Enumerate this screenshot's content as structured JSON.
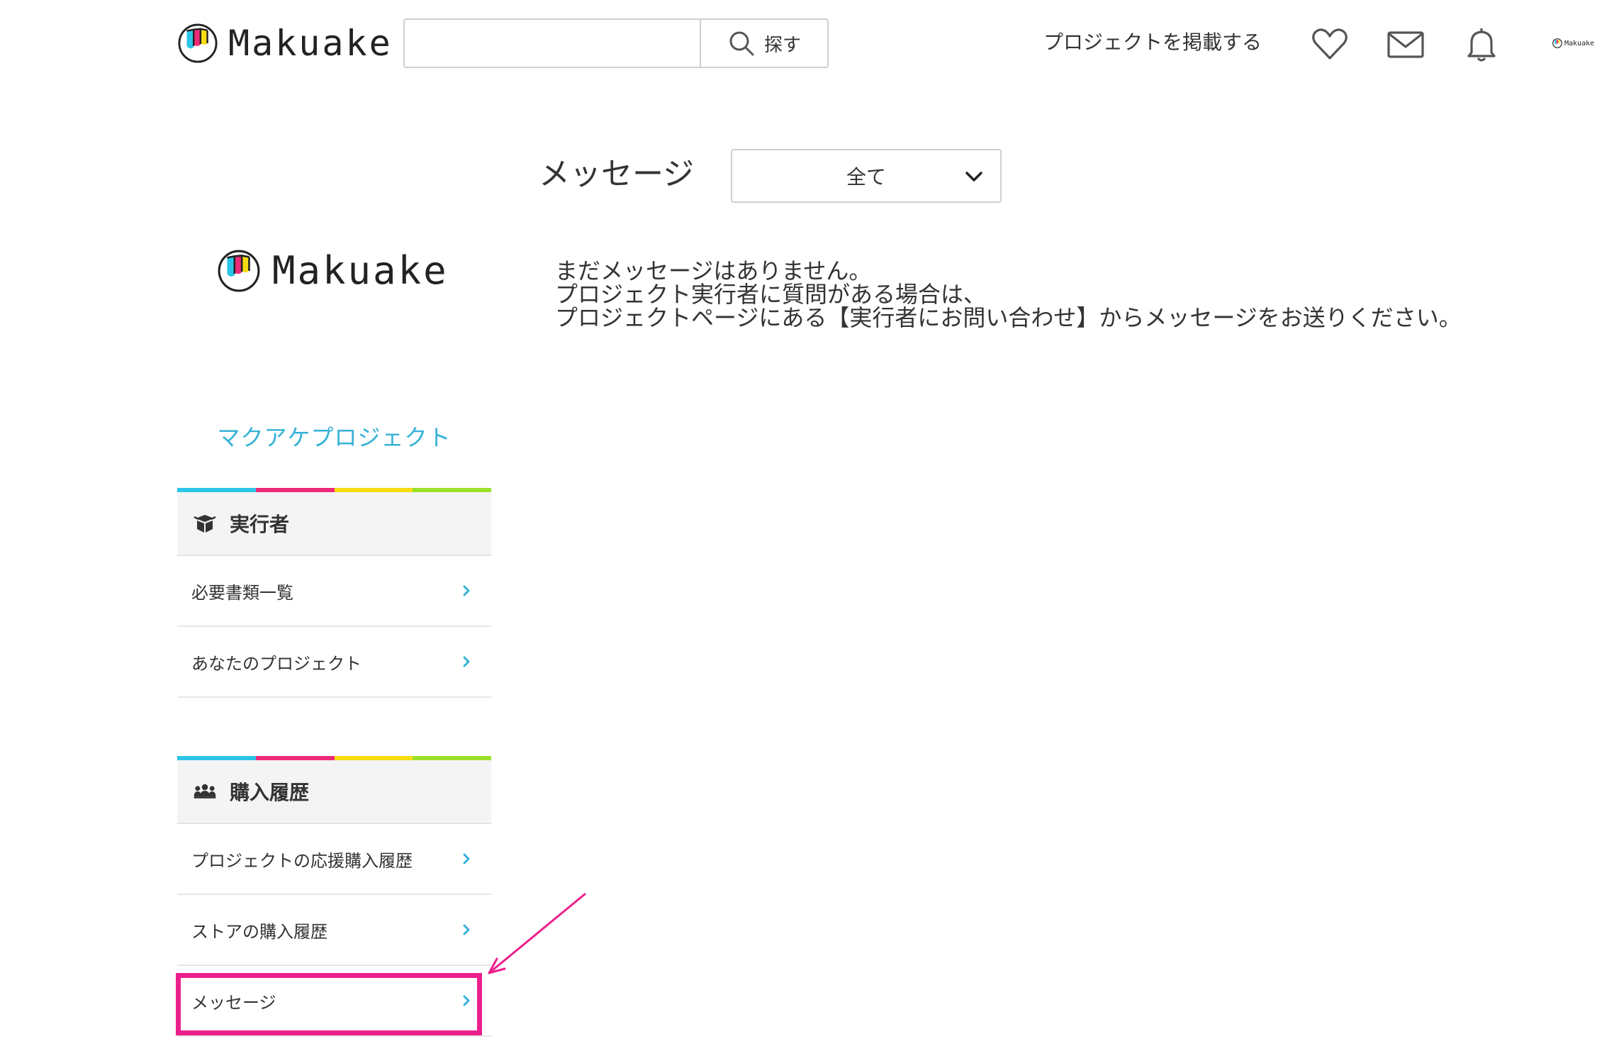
{
  "header": {
    "logo_text": "Makuake",
    "search": {
      "value": "",
      "placeholder": "",
      "button_label": "探す"
    },
    "post_project_label": "プロジェクトを掲載する",
    "icons": [
      "heart-icon",
      "mail-icon",
      "bell-icon"
    ],
    "avatar_text": "Makuake"
  },
  "main": {
    "title": "メッセージ",
    "filter": {
      "selected": "全て"
    },
    "empty_state": {
      "line1": "まだメッセージはありません。",
      "line2": "プロジェクト実行者に質問がある場合は、",
      "line3": "プロジェクトページにある【実行者にお問い合わせ】からメッセージをお送りください。"
    }
  },
  "sidebar": {
    "logo_text": "Makuake",
    "title": "マクアケプロジェクト",
    "sections": [
      {
        "label": "実行者",
        "icon": "box-icon",
        "items": [
          {
            "label": "必要書類一覧"
          },
          {
            "label": "あなたのプロジェクト"
          }
        ]
      },
      {
        "label": "購入履歴",
        "icon": "people-icon",
        "items": [
          {
            "label": "プロジェクトの応援購入履歴"
          },
          {
            "label": "ストアの購入履歴"
          },
          {
            "label": "メッセージ"
          }
        ]
      }
    ]
  },
  "colors": {
    "accent": "#35b2d6",
    "brand_cyan": "#2cc4e8",
    "brand_pink": "#ec2a79",
    "brand_yellow": "#f7dc12",
    "brand_green": "#9ae22a",
    "highlight": "#ec1f8c"
  }
}
